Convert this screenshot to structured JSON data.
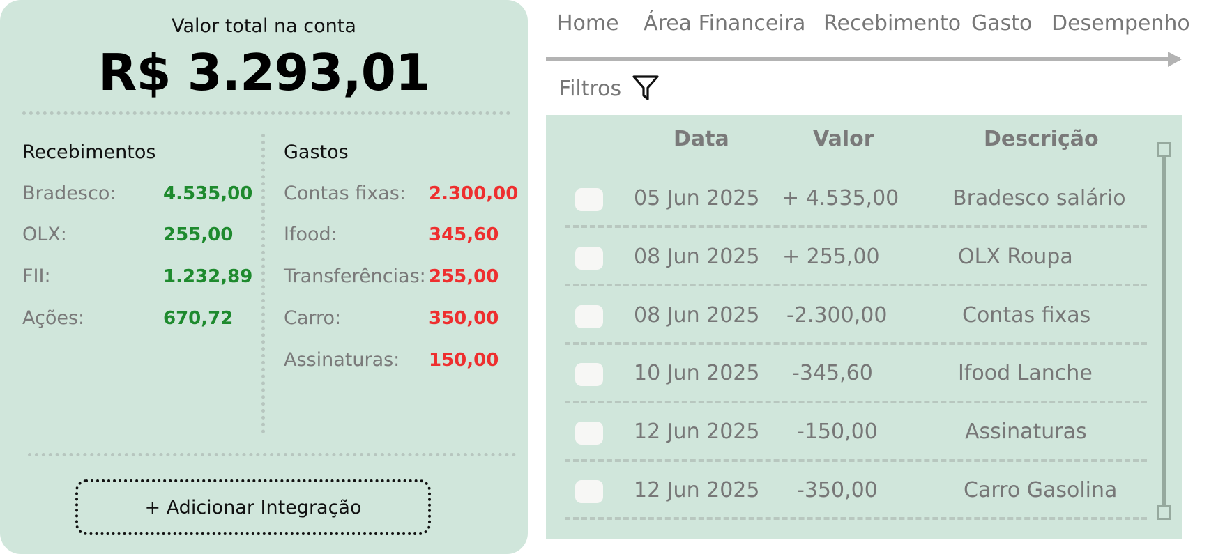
{
  "summary": {
    "total_label": "Valor total na conta",
    "total_value": "R$ 3.293,01"
  },
  "receipts": {
    "title": "Recebimentos",
    "items": [
      {
        "label": "Bradesco:",
        "value": "4.535,00"
      },
      {
        "label": "OLX:",
        "value": "255,00"
      },
      {
        "label": "FII:",
        "value": "1.232,89"
      },
      {
        "label": "Ações:",
        "value": "670,72"
      }
    ]
  },
  "expenses": {
    "title": "Gastos",
    "items": [
      {
        "label": "Contas fixas:",
        "value": "2.300,00"
      },
      {
        "label": "Ifood:",
        "value": "345,60"
      },
      {
        "label": "Transferências:",
        "value": "255,00"
      },
      {
        "label": "Carro:",
        "value": "350,00"
      },
      {
        "label": "Assinaturas:",
        "value": "150,00"
      }
    ]
  },
  "add_integration_label": "+ Adicionar Integração",
  "nav": {
    "items": [
      "Home",
      "Área Financeira",
      "Recebimento",
      "Gasto",
      "Desempenho"
    ]
  },
  "filters": {
    "label": "Filtros",
    "icon": "funnel-icon"
  },
  "table": {
    "headers": [
      "Data",
      "Valor",
      "Descrição"
    ],
    "rows": [
      {
        "date": "05 Jun 2025",
        "value": "+ 4.535,00",
        "description": "Bradesco salário"
      },
      {
        "date": "08 Jun 2025",
        "value": "+ 255,00",
        "description": "OLX Roupa"
      },
      {
        "date": "08 Jun 2025",
        "value": "-2.300,00",
        "description": "Contas fixas"
      },
      {
        "date": "10 Jun 2025",
        "value": "-345,60",
        "description": "Ifood Lanche"
      },
      {
        "date": "12 Jun 2025",
        "value": "-150,00",
        "description": "Assinaturas"
      },
      {
        "date": "12 Jun 2025",
        "value": "-350,00",
        "description": "Carro Gasolina"
      }
    ]
  },
  "colors": {
    "panel_bg": "#d0e6db",
    "income": "#1e8a2e",
    "expense": "#ee2f2f"
  }
}
